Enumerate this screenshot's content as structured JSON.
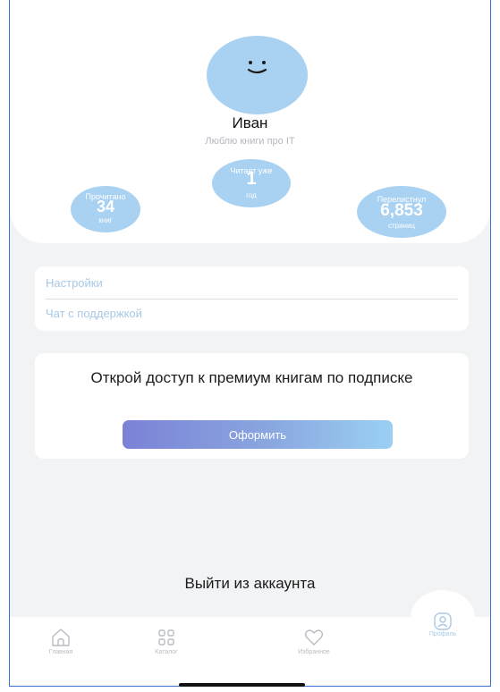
{
  "profile": {
    "name": "Иван",
    "bio": "Люблю книги про IT",
    "stats": {
      "read": {
        "caption": "Прочитано",
        "value": "34",
        "unit": "книг"
      },
      "years": {
        "caption": "Читает уже",
        "value": "1",
        "unit": "год"
      },
      "pages": {
        "caption": "Перелистнул",
        "value": "6,853",
        "unit": "страниц"
      }
    }
  },
  "menu": {
    "settings": "Настройки",
    "support": "Чат с поддержкой"
  },
  "promo": {
    "title": "Открой доступ к премиум книгам по подписке",
    "button": "Оформить"
  },
  "logout": "Выйти из аккаунта",
  "tabs": {
    "home": {
      "label": "Главная",
      "icon": "home-icon"
    },
    "catalog": {
      "label": "Каталог",
      "icon": "grid-icon"
    },
    "favorites": {
      "label": "Избранное",
      "icon": "heart-icon"
    },
    "profile": {
      "label": "Профиль",
      "icon": "profile-icon"
    }
  },
  "colors": {
    "accent": "#a9d2f2",
    "link": "#a8c8e6",
    "background": "#f2f3f5"
  }
}
